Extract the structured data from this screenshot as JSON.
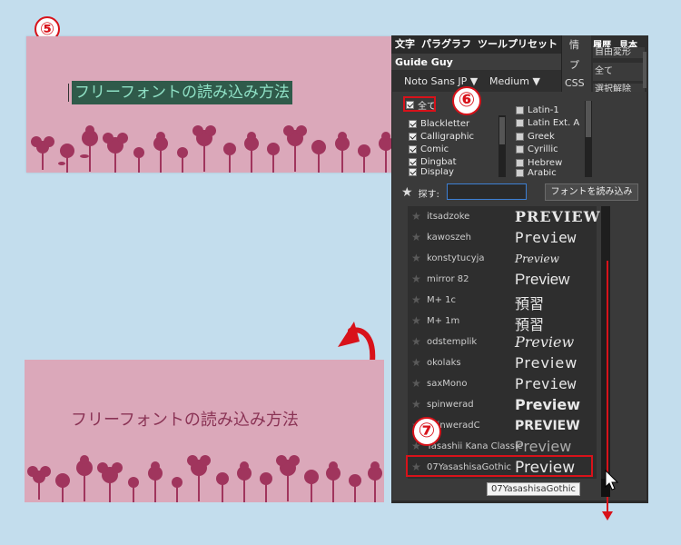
{
  "steps": {
    "five": "⑤",
    "six": "⑥",
    "seven": "⑦"
  },
  "card": {
    "title": "フリーフォントの読み込み方法"
  },
  "panel": {
    "tabs": [
      "文字",
      "パラグラフ",
      "ツールプリセット"
    ],
    "guide_tab": "Guide Guy",
    "font_family": "Noto Sans JP ▼",
    "font_weight": "Medium ▼",
    "side_col": [
      "情",
      "プ",
      "CSS"
    ],
    "right_tabs": [
      "履歴",
      "見本"
    ],
    "right_rows": [
      "自由変形",
      "全て",
      "選択解除"
    ],
    "checkbox_all": "全て",
    "categories_left": [
      "Blackletter",
      "Calligraphic",
      "Comic",
      "Dingbat",
      "Display"
    ],
    "categories_right": [
      "Latin-1",
      "Latin Ext. A",
      "Greek",
      "Cyrillic",
      "Hebrew",
      "Arabic"
    ],
    "search_label": "探す:",
    "search_value": "",
    "load_button": "フォントを読み込み",
    "fonts": [
      {
        "name": "itsadzoke",
        "preview": "PREVIEW"
      },
      {
        "name": "kawoszeh",
        "preview": "Preview"
      },
      {
        "name": "konstytucyja",
        "preview": "Preview"
      },
      {
        "name": "mirror 82",
        "preview": "Preview"
      },
      {
        "name": "M+ 1c",
        "preview": "預習"
      },
      {
        "name": "M+ 1m",
        "preview": "預習"
      },
      {
        "name": "odstemplik",
        "preview": "Preview"
      },
      {
        "name": "okolaks",
        "preview": "Preview"
      },
      {
        "name": "saxMono",
        "preview": "Preview"
      },
      {
        "name": "spinwerad",
        "preview": "Preview"
      },
      {
        "name": "spinweradC",
        "preview": "PREVIEW"
      },
      {
        "name": "Yasashii Kana Classic",
        "preview": "Preview"
      },
      {
        "name": "07YasashisaGothic",
        "preview": "Preview"
      }
    ],
    "tooltip": "07YasashisaGothic"
  },
  "colors": {
    "card_bg": "#dba8ba",
    "flower": "#a0355d",
    "highlight_red": "#d8121a",
    "panel_bg": "#2b2b2b"
  }
}
